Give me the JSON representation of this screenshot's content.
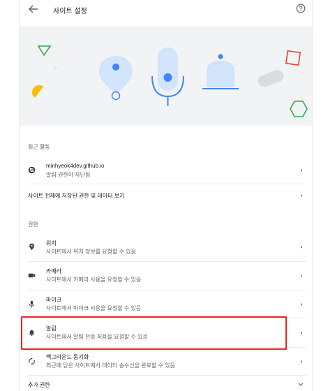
{
  "header": {
    "title": "사이트 설정",
    "back_icon": "arrow-back-icon",
    "help_icon": "help-icon"
  },
  "hero": {
    "icons": [
      "location-pin-illustration",
      "microphone-illustration",
      "bell-illustration"
    ],
    "colors": {
      "accent_blue": "#4285f4",
      "light_blue": "#d2e3fc",
      "yellow": "#fbbc04",
      "green": "#34a853",
      "red": "#ea4335",
      "gray": "#dadce0"
    }
  },
  "recent_activity": {
    "section_label": "최근 활동",
    "items": [
      {
        "title": "minhyeok4dev.github.io",
        "subtitle": "알림 권한이 차단됨",
        "icon": "site-icon"
      }
    ]
  },
  "all_sites": {
    "label": "사이트 전체에 저장된 권한 및 데이터 보기"
  },
  "permissions": {
    "section_label": "권한",
    "items": [
      {
        "title": "위치",
        "subtitle": "사이트에서 위치 정보를 요청할 수 있음",
        "icon": "location-icon"
      },
      {
        "title": "카메라",
        "subtitle": "사이트에서 카메라 사용을 요청할 수 있음",
        "icon": "camera-icon"
      },
      {
        "title": "마이크",
        "subtitle": "사이트에서 마이크 사용을 요청할 수 있음",
        "icon": "mic-icon"
      },
      {
        "title": "알림",
        "subtitle": "사이트에서 알림 전송 허용을 요청할 수 있음",
        "icon": "notifications-icon"
      },
      {
        "title": "백그라운드 동기화",
        "subtitle": "최근에 닫은 사이트에서 데이터 송수신을 완료할 수 있음",
        "icon": "sync-icon"
      }
    ]
  },
  "additional": {
    "label": "추가 권한"
  },
  "highlight_color": "#e8281c"
}
